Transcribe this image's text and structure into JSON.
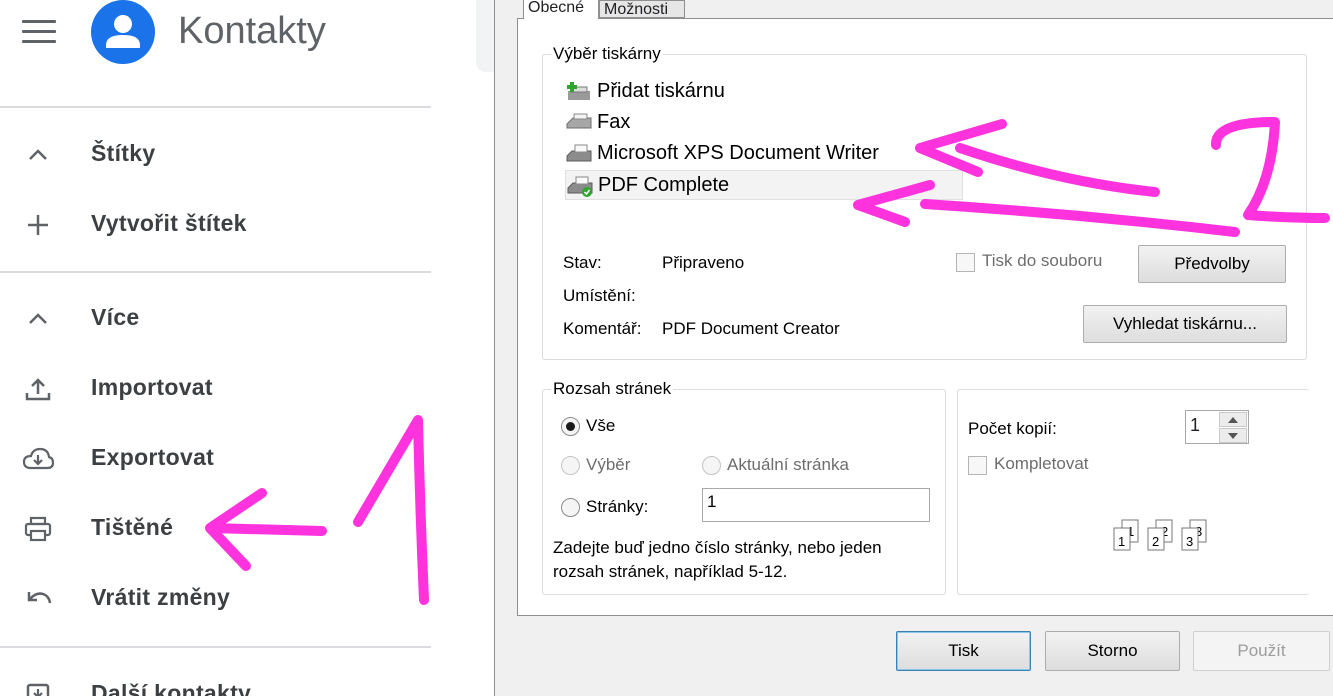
{
  "app": {
    "title": "Kontakty"
  },
  "sidebar": {
    "items": [
      {
        "key": "labels",
        "label": "Štítky",
        "icon": "chevron-up-icon"
      },
      {
        "key": "create-label",
        "label": "Vytvořit štítek",
        "icon": "plus-icon"
      },
      {
        "key": "more",
        "label": "Více",
        "icon": "chevron-up-icon"
      },
      {
        "key": "import",
        "label": "Importovat",
        "icon": "upload-icon"
      },
      {
        "key": "export",
        "label": "Exportovat",
        "icon": "cloud-download-icon"
      },
      {
        "key": "print",
        "label": "Tištěné",
        "icon": "printer-icon"
      },
      {
        "key": "undo",
        "label": "Vrátit změny",
        "icon": "undo-icon"
      },
      {
        "key": "other-contacts",
        "label": "Další kontakty",
        "icon": "inbox-icon"
      }
    ]
  },
  "dialog": {
    "tabs": [
      {
        "label": "Obecné",
        "active": true
      },
      {
        "label": "Možnosti",
        "active": false
      }
    ],
    "printer_group": {
      "label": "Výběr tiskárny",
      "printers": [
        {
          "label": "Přidat tiskárnu",
          "icon": "add-printer-icon",
          "selected": false
        },
        {
          "label": "Fax",
          "icon": "fax-icon",
          "selected": false
        },
        {
          "label": "Microsoft XPS Document Writer",
          "icon": "printer-icon",
          "selected": false
        },
        {
          "label": "PDF Complete",
          "icon": "default-printer-icon",
          "selected": true
        }
      ],
      "status_label": "Stav:",
      "status_value": "Připraveno",
      "location_label": "Umístění:",
      "location_value": "",
      "comment_label": "Komentář:",
      "comment_value": "PDF Document Creator",
      "print_to_file_label": "Tisk do souboru",
      "print_to_file_checked": false,
      "preferences_button": "Předvolby",
      "find_printer_button": "Vyhledat tiskárnu..."
    },
    "range_group": {
      "label": "Rozsah stránek",
      "all_label": "Vše",
      "selection_label": "Výběr",
      "current_page_label": "Aktuální stránka",
      "pages_label": "Stránky:",
      "pages_value": "1",
      "hint": "Zadejte buď jedno číslo stránky, nebo jeden rozsah stránek, například 5-12.",
      "selected": "all"
    },
    "copies_group": {
      "copies_label": "Počet kopií:",
      "copies_value": "1",
      "collate_label": "Kompletovat",
      "collate_checked": false,
      "collate_pages": [
        "1",
        "1",
        "2",
        "2",
        "3",
        "3"
      ]
    },
    "buttons": {
      "print": "Tisk",
      "cancel": "Storno",
      "apply": "Použít"
    }
  },
  "annotations": {
    "color": "#ff33dd",
    "marks": [
      "1",
      "2"
    ]
  },
  "colors": {
    "avatar": "#1a73e8",
    "annotation": "#ff33dd"
  }
}
